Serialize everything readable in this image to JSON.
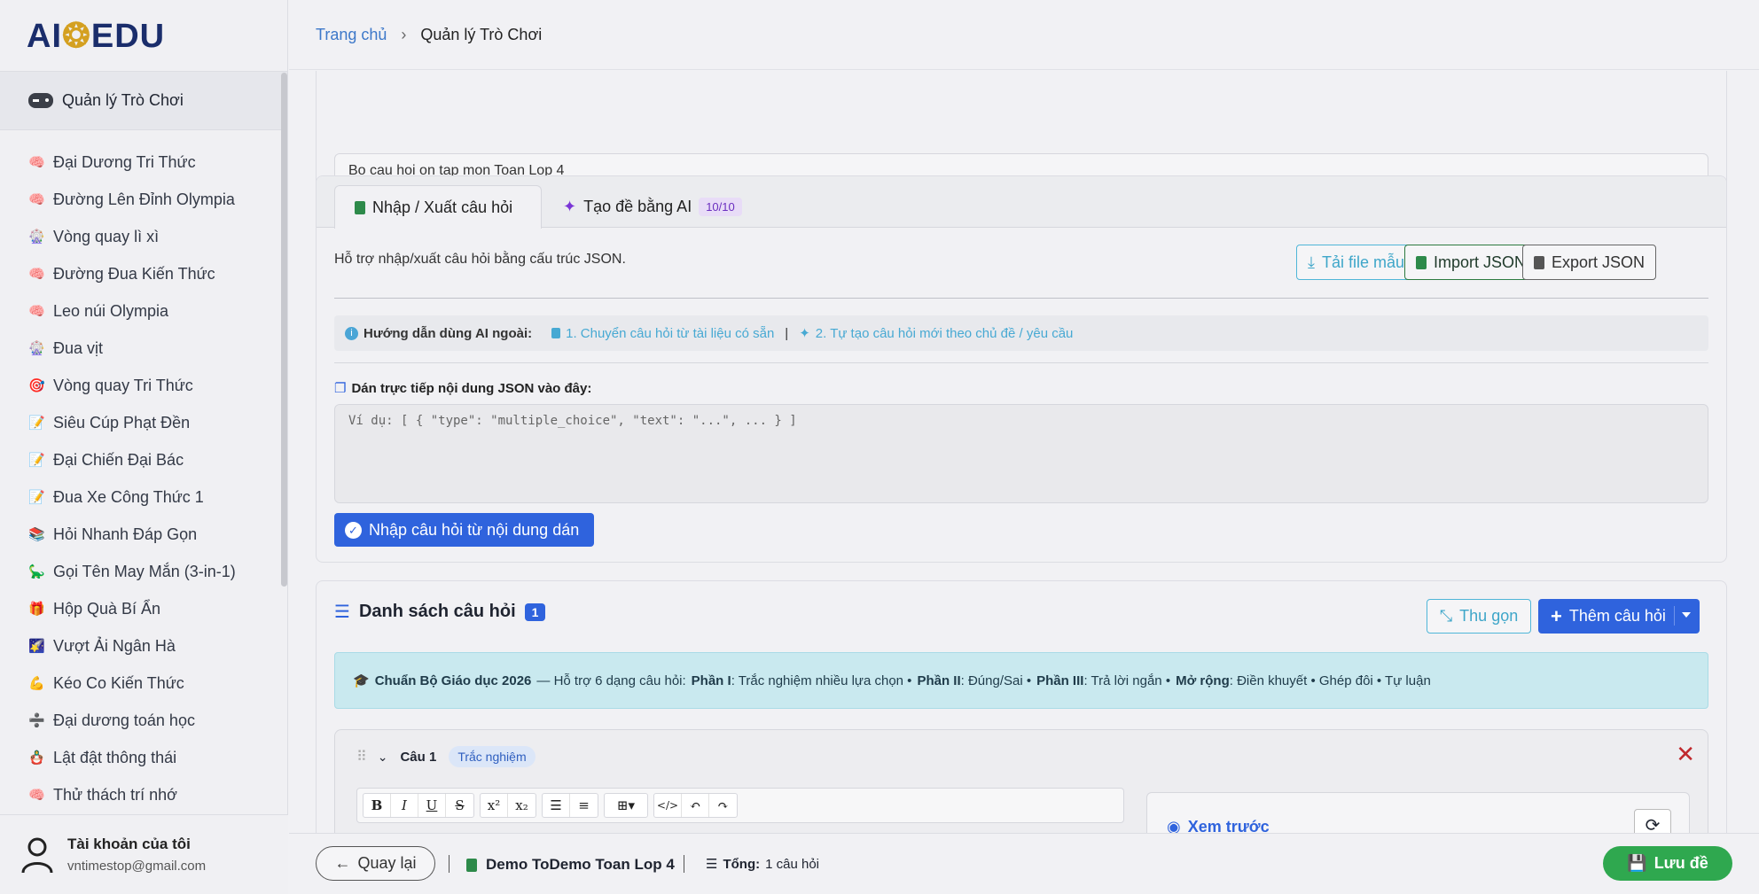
{
  "app": {
    "logo_part1": "AI",
    "logo_part2": "EDU"
  },
  "breadcrumb": {
    "home": "Trang chủ",
    "current": "Quản lý Trò Chơi"
  },
  "sidebar": {
    "header": "Quản lý Trò Chơi",
    "items": [
      {
        "label": "Đại Dương Tri Thức",
        "icon": "🧠"
      },
      {
        "label": "Đường Lên Đỉnh Olympia",
        "icon": "🧠"
      },
      {
        "label": "Vòng quay lì xì",
        "icon": "🎡"
      },
      {
        "label": "Đường Đua Kiến Thức",
        "icon": "🧠"
      },
      {
        "label": "Leo núi Olympia",
        "icon": "🧠"
      },
      {
        "label": "Đua vịt",
        "icon": "🎡"
      },
      {
        "label": "Vòng quay Tri Thức",
        "icon": "🎯"
      },
      {
        "label": "Siêu Cúp Phạt Đền",
        "icon": "📝"
      },
      {
        "label": "Đại Chiến Đại Bác",
        "icon": "📝"
      },
      {
        "label": "Đua Xe Công Thức 1",
        "icon": "📝"
      },
      {
        "label": "Hỏi Nhanh Đáp Gọn",
        "icon": "📚"
      },
      {
        "label": "Gọi Tên May Mắn (3-in-1)",
        "icon": "🦕"
      },
      {
        "label": "Hộp Quà Bí Ẩn",
        "icon": "🎁"
      },
      {
        "label": "Vượt Ải Ngân Hà",
        "icon": "🌠"
      },
      {
        "label": "Kéo Co Kiến Thức",
        "icon": "💪"
      },
      {
        "label": "Đại dương toán học",
        "icon": "➗"
      },
      {
        "label": "Lật đật thông thái",
        "icon": "🪆"
      },
      {
        "label": "Thử thách trí nhớ",
        "icon": "🧠"
      }
    ],
    "account": {
      "name": "Tài khoản của tôi",
      "email": "vntimestop@gmail.com"
    }
  },
  "description": {
    "value": "Bo cau hoi on tap mon Toan Lop 4"
  },
  "import": {
    "tab_active": "Nhập / Xuất câu hỏi",
    "tab_ai": "Tạo đề bằng AI",
    "ai_quota": "10/10",
    "hint": "Hỗ trợ nhập/xuất câu hỏi bằng cấu trúc JSON.",
    "btn_download": "Tải file mẫu",
    "btn_import": "Import JSON",
    "btn_export": "Export JSON",
    "guide_label": "Hướng dẫn dùng AI ngoài:",
    "guide_link1": "1. Chuyển câu hỏi từ tài liệu có sẵn",
    "guide_link2": "2. Tự tạo câu hỏi mới theo chủ đề / yêu cầu",
    "paste_label": "Dán trực tiếp nội dung JSON vào đây:",
    "paste_placeholder": "Ví dụ: [ { \"type\": \"multiple_choice\", \"text\": \"...\", ... } ]",
    "btn_paste_import": "Nhập câu hỏi từ nội dung dán"
  },
  "list": {
    "title": "Danh sách câu hỏi",
    "count": "1",
    "btn_collapse": "Thu gọn",
    "btn_add": "Thêm câu hỏi",
    "std_title": "Chuẩn Bộ Giáo dục 2026",
    "std_text1": "— Hỗ trợ 6 dạng câu hỏi:",
    "std_p1": "Phần I",
    "std_p1_text": ": Trắc nghiệm nhiều lựa chọn •",
    "std_p2": "Phần II",
    "std_p2_text": ": Đúng/Sai •",
    "std_p3": "Phần III",
    "std_p3_text": ": Trả lời ngắn •",
    "std_ext": "Mở rộng",
    "std_ext_text": ": Điền khuyết • Ghép đôi • Tự luận",
    "question": {
      "label": "Câu 1",
      "type": "Trắc nghiệm",
      "preview_title": "Xem trước"
    }
  },
  "bottom": {
    "btn_back": "Quay lại",
    "name": "Demo ToDemo Toan Lop 4",
    "total_label": "Tổng:",
    "total_value": "1 câu hỏi",
    "btn_save": "Lưu đề"
  }
}
